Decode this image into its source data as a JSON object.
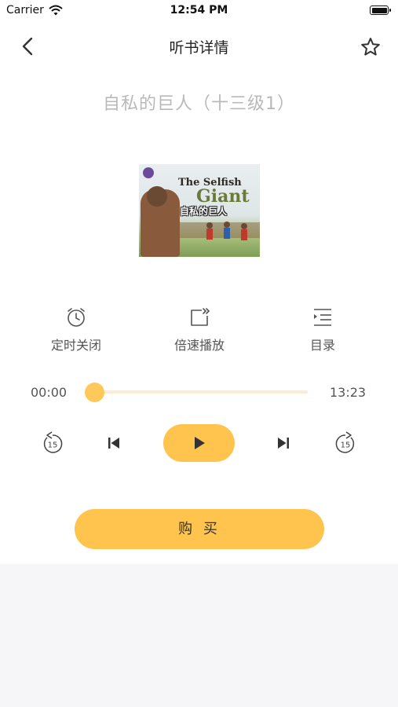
{
  "status_bar": {
    "carrier": "Carrier",
    "time": "12:54 PM"
  },
  "nav": {
    "title": "听书详情",
    "back_icon": "chevron-left-icon",
    "favorite_icon": "star-outline-icon"
  },
  "book": {
    "title": "自私的巨人（十三级1）",
    "cover_text_en_line1": "The Selfish",
    "cover_text_en_line2": "Giant",
    "cover_text_cn": "自私的巨人"
  },
  "functions": [
    {
      "label": "定时关闭",
      "icon": "alarm-clock-icon"
    },
    {
      "label": "倍速播放",
      "icon": "speed-play-icon"
    },
    {
      "label": "目录",
      "icon": "playlist-icon"
    }
  ],
  "player": {
    "current_time": "00:00",
    "total_time": "13:23",
    "progress": 0,
    "rewind_seconds": "15",
    "forward_seconds": "15"
  },
  "buy": {
    "label": "购 买"
  },
  "colors": {
    "accent": "#ffc44d",
    "track": "#fdebd6",
    "title_gray": "#b9b9b9",
    "background_bottom": "#f6f6f8"
  }
}
